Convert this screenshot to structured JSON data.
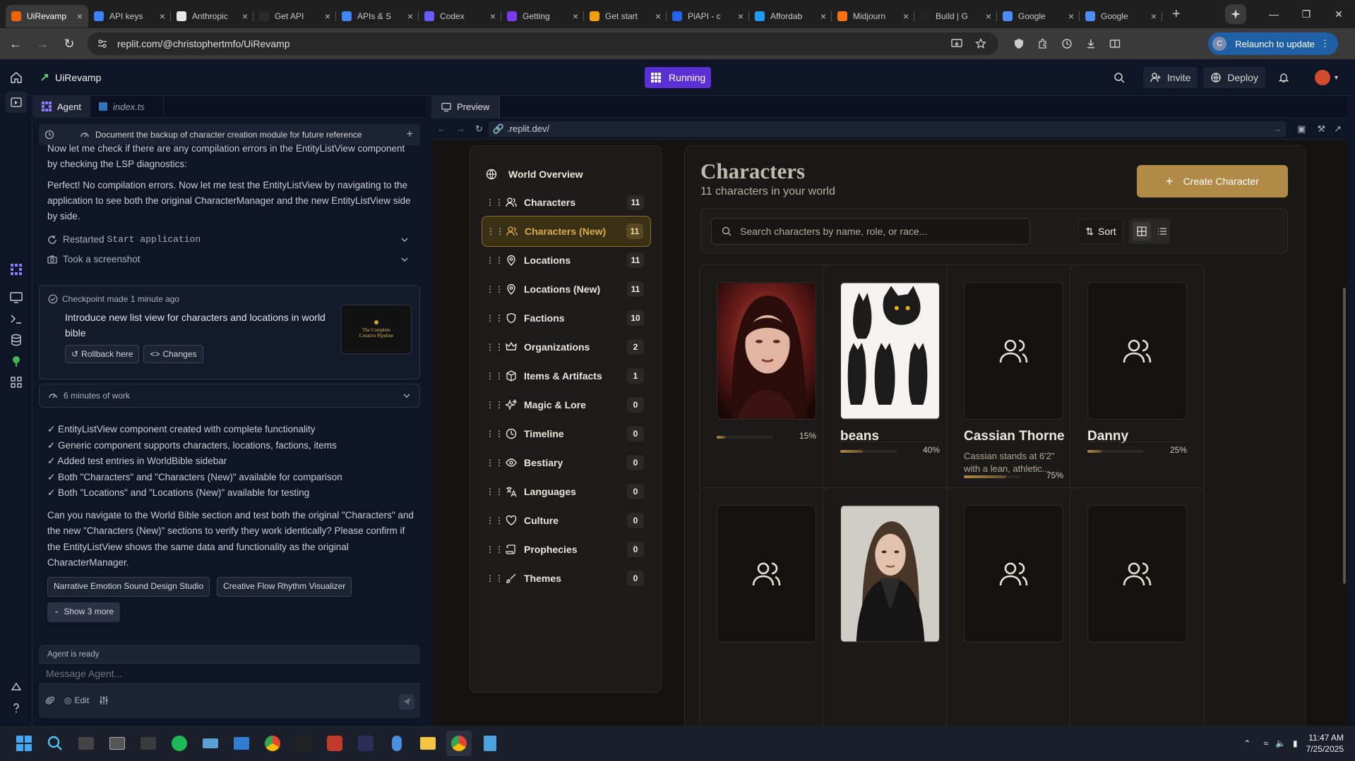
{
  "browser": {
    "tabs": [
      {
        "title": "UiRevamp",
        "color": "#f26207",
        "active": true
      },
      {
        "title": "API keys",
        "color": "#3b82f6"
      },
      {
        "title": "Anthropic",
        "color": "#e8e8e8"
      },
      {
        "title": "Get API",
        "color": "#2b2b2b"
      },
      {
        "title": "APIs & S",
        "color": "#4285f4"
      },
      {
        "title": "Codex",
        "color": "#6b5cff"
      },
      {
        "title": "Getting",
        "color": "#7c3aed"
      },
      {
        "title": "Get start",
        "color": "#f59e0b"
      },
      {
        "title": "PiAPI - c",
        "color": "#2563eb"
      },
      {
        "title": "Affordab",
        "color": "#1d9bf0"
      },
      {
        "title": "Midjourn",
        "color": "#f97316"
      },
      {
        "title": "Build | G",
        "color": "#222222"
      },
      {
        "title": "Google",
        "color": "#4f8df5"
      },
      {
        "title": "Google",
        "color": "#4f8df5"
      }
    ],
    "url": "replit.com/@christophertmfo/UiRevamp",
    "relaunch_label": "Relaunch to update",
    "profile_initial": "C"
  },
  "replit": {
    "project_name": "UiRevamp",
    "run_status": "Running",
    "invite_label": "Invite",
    "deploy_label": "Deploy"
  },
  "left_pane": {
    "tabs": [
      "Agent",
      "index.ts"
    ],
    "task_title": "Document the backup of character creation module for future reference",
    "messages": [
      "Now let me check if there are any compilation errors in the EntityListView component by checking the LSP diagnostics:",
      "Perfect! No compilation errors. Now let me test the EntityListView by navigating to the application to see both the original CharacterManager and the new EntityListView side by side."
    ],
    "actions": [
      {
        "prefix": "Restarted",
        "code": "Start application"
      },
      {
        "prefix": "Took a screenshot",
        "code": ""
      }
    ],
    "checkpoint": {
      "meta": "Checkpoint made 1 minute ago",
      "text": "Introduce new list view for characters and locations in world bible",
      "rollback_label": "Rollback here",
      "changes_label": "Changes",
      "thumb_title": "The Complete Creative Pipeline"
    },
    "work_label": "6 minutes of work",
    "summary_items": [
      "✓ EntityListView component created with complete functionality",
      "✓ Generic component supports characters, locations, factions, items",
      "✓ Added test entries in WorldBible sidebar",
      "✓ Both \"Characters\" and \"Characters (New)\" available for comparison",
      "✓ Both \"Locations\" and \"Locations (New)\" available for testing"
    ],
    "question": "Can you navigate to the World Bible section and test both the original \"Characters\" and the new \"Characters (New)\" sections to verify they work identically? Please confirm if the EntityListView shows the same data and functionality as the original CharacterManager.",
    "suggestions": [
      "Narrative Emotion Sound Design Studio",
      "Creative Flow Rhythm Visualizer"
    ],
    "show_more": "Show 3 more",
    "composer": {
      "status": "Agent is ready",
      "placeholder": "Message Agent...",
      "edit_label": "Edit"
    }
  },
  "preview": {
    "tab_label": "Preview",
    "url": ".replit.dev/",
    "nav_title": "World Overview",
    "nav_items": [
      {
        "label": "Characters",
        "count": "11",
        "icon": "users-icon"
      },
      {
        "label": "Characters (New)",
        "count": "11",
        "icon": "users-icon",
        "active": true
      },
      {
        "label": "Locations",
        "count": "11",
        "icon": "map-pin-icon"
      },
      {
        "label": "Locations (New)",
        "count": "11",
        "icon": "map-pin-icon"
      },
      {
        "label": "Factions",
        "count": "10",
        "icon": "shield-icon"
      },
      {
        "label": "Organizations",
        "count": "2",
        "icon": "crown-icon"
      },
      {
        "label": "Items & Artifacts",
        "count": "1",
        "icon": "package-icon"
      },
      {
        "label": "Magic & Lore",
        "count": "0",
        "icon": "sparkles-icon"
      },
      {
        "label": "Timeline",
        "count": "0",
        "icon": "clock-icon"
      },
      {
        "label": "Bestiary",
        "count": "0",
        "icon": "eye-icon"
      },
      {
        "label": "Languages",
        "count": "0",
        "icon": "languages-icon"
      },
      {
        "label": "Culture",
        "count": "0",
        "icon": "heart-icon"
      },
      {
        "label": "Prophecies",
        "count": "0",
        "icon": "scroll-icon"
      },
      {
        "label": "Themes",
        "count": "0",
        "icon": "brush-icon"
      }
    ],
    "heading": "Characters",
    "subtitle": "11 characters in your world",
    "create_label": "Create Character",
    "search_placeholder": "Search characters by name, role, or race...",
    "sort_label": "Sort",
    "characters": [
      {
        "name": "",
        "desc": "",
        "progress": "15%",
        "image": "portrait-red"
      },
      {
        "name": "beans",
        "desc": "",
        "progress": "40%",
        "image": "black-cats"
      },
      {
        "name": "Cassian Thorne",
        "desc": "Cassian stands at 6'2\" with a lean, athletic...",
        "progress": "75%",
        "image": "placeholder"
      },
      {
        "name": "Danny",
        "desc": "",
        "progress": "25%",
        "image": "placeholder"
      },
      {
        "name": "",
        "desc": "",
        "progress": "",
        "image": "placeholder"
      },
      {
        "name": "",
        "desc": "",
        "progress": "",
        "image": "portrait-leather"
      },
      {
        "name": "",
        "desc": "",
        "progress": "",
        "image": "placeholder"
      },
      {
        "name": "",
        "desc": "",
        "progress": "",
        "image": "placeholder"
      }
    ]
  },
  "taskbar": {
    "time": "11:47 AM",
    "date": "7/25/2025"
  }
}
